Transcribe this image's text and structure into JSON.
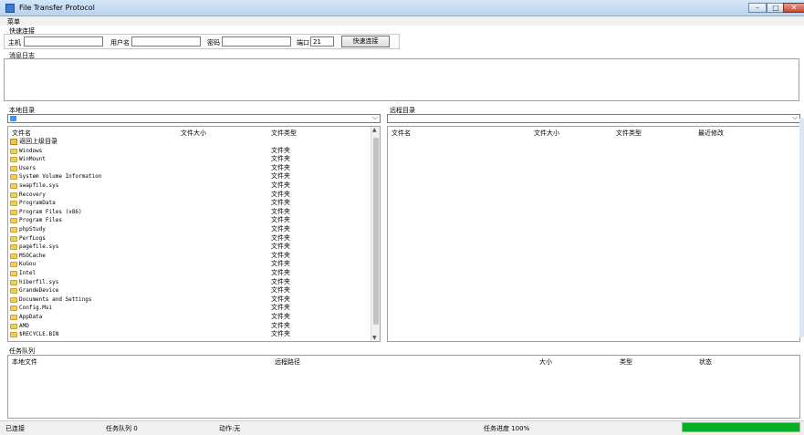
{
  "window": {
    "title": "File Transfer Protocol"
  },
  "menu": {
    "main": "菜单"
  },
  "quick_connect": {
    "section_label": "快速连接",
    "host_label": "主机",
    "host_value": "",
    "user_label": "用户名",
    "user_value": "",
    "password_label": "密码",
    "password_value": "",
    "port_label": "端口",
    "port_value": "21",
    "connect_label": "快速连接"
  },
  "log": {
    "label": "消息日志"
  },
  "local": {
    "label": "本地目录",
    "columns": [
      "文件名",
      "文件大小",
      "文件类型"
    ],
    "up_label": "返回上级目录",
    "items": [
      {
        "name": "Windows",
        "type": "文件夹"
      },
      {
        "name": "WinMount",
        "type": "文件夹"
      },
      {
        "name": "Users",
        "type": "文件夹"
      },
      {
        "name": "System Volume Information",
        "type": "文件夹"
      },
      {
        "name": "swapfile.sys",
        "type": "文件夹"
      },
      {
        "name": "Recovery",
        "type": "文件夹"
      },
      {
        "name": "ProgramData",
        "type": "文件夹"
      },
      {
        "name": "Program Files (x86)",
        "type": "文件夹"
      },
      {
        "name": "Program Files",
        "type": "文件夹"
      },
      {
        "name": "phpStudy",
        "type": "文件夹"
      },
      {
        "name": "PerfLogs",
        "type": "文件夹"
      },
      {
        "name": "pagefile.sys",
        "type": "文件夹"
      },
      {
        "name": "MSOCache",
        "type": "文件夹"
      },
      {
        "name": "KuGou",
        "type": "文件夹"
      },
      {
        "name": "Intel",
        "type": "文件夹"
      },
      {
        "name": "hiberfil.sys",
        "type": "文件夹"
      },
      {
        "name": "GrandeDevice",
        "type": "文件夹"
      },
      {
        "name": "Documents and Settings",
        "type": "文件夹"
      },
      {
        "name": "Config.Msi",
        "type": "文件夹"
      },
      {
        "name": "AppData",
        "type": "文件夹"
      },
      {
        "name": "AMD",
        "type": "文件夹"
      },
      {
        "name": "$RECYCLE.BIN",
        "type": "文件夹"
      }
    ]
  },
  "remote": {
    "label": "远程目录",
    "columns": [
      "文件名",
      "文件大小",
      "文件类型",
      "最近修改"
    ]
  },
  "queue": {
    "label": "任务队列",
    "columns": [
      "本地文件",
      "远程路径",
      "大小",
      "类型",
      "状态"
    ]
  },
  "status": {
    "connection": "已连接",
    "queue": "任务队列 0",
    "action": "动作:无",
    "progress_text": "任务进度 100%",
    "progress_fraction": 1.0
  },
  "colors": {
    "accent": "#3399ff",
    "progress": "#06b025",
    "folder": "#f2cf5b"
  }
}
